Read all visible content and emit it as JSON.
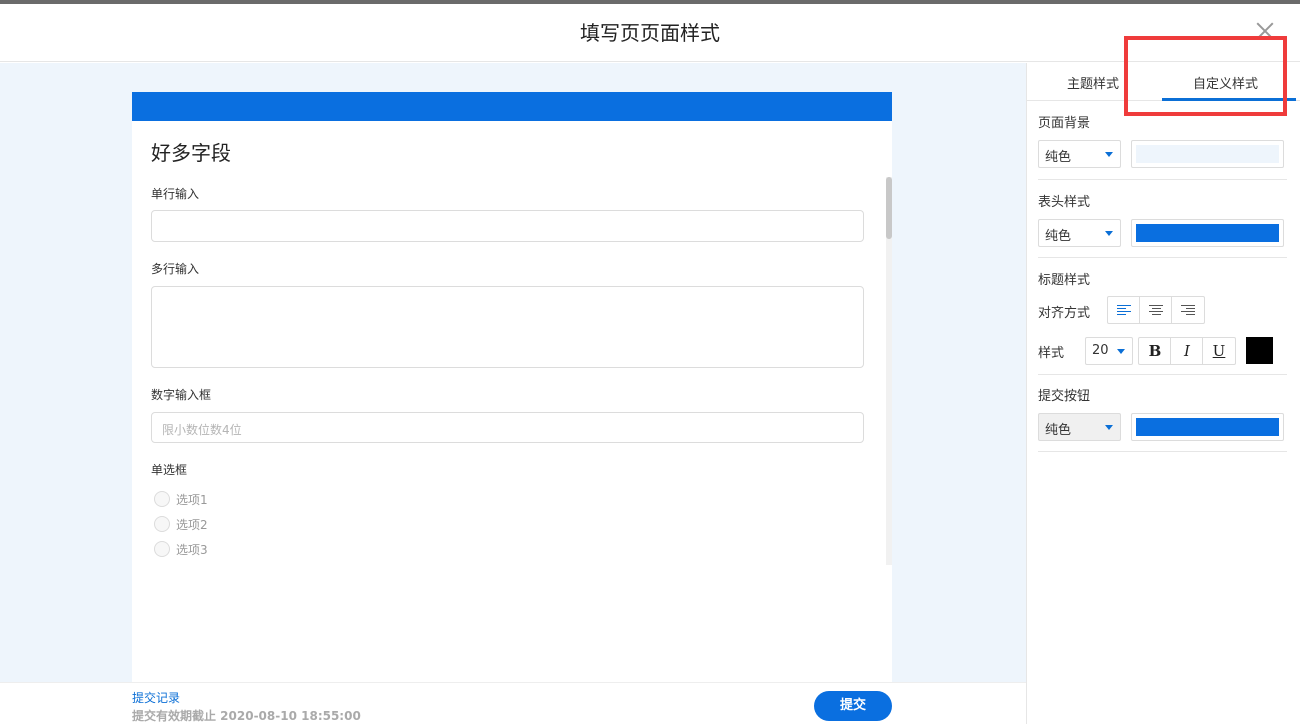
{
  "dialog": {
    "title": "填写页页面样式"
  },
  "form": {
    "title": "好多字段",
    "banner_color": "#0a6fe0",
    "fields": [
      {
        "label": "单行输入",
        "placeholder": ""
      },
      {
        "label": "多行输入",
        "placeholder": ""
      },
      {
        "label": "数字输入框",
        "placeholder": "限小数位数4位"
      },
      {
        "label": "单选框",
        "options": [
          "选项1",
          "选项2",
          "选项3"
        ]
      }
    ]
  },
  "footer": {
    "records_link": "提交记录",
    "deadline": "提交有效期截止 2020-08-10 18:55:00",
    "submit_label": "提交",
    "submit_color": "#0a6fe0"
  },
  "panel": {
    "tabs": [
      "主题样式",
      "自定义样式"
    ],
    "active_tab": "自定义样式",
    "accent_color": "#0b6fd6",
    "page_background": {
      "title": "页面背景",
      "fill_type": "纯色",
      "color": "#eef5fc"
    },
    "header_style": {
      "title": "表头样式",
      "fill_type": "纯色",
      "color": "#0a6fe0"
    },
    "title_style": {
      "title": "标题样式",
      "align_label": "对齐方式",
      "align_options": [
        "align-left",
        "align-center",
        "align-right"
      ],
      "align_selected": "align-left",
      "style_label": "样式",
      "font_size": "20",
      "format_buttons": [
        "B",
        "I",
        "U"
      ],
      "color": "#000000"
    },
    "submit_button": {
      "title": "提交按钮",
      "fill_type": "纯色",
      "color": "#0a6fe0"
    }
  },
  "annotation": {
    "highlight_color": "#ef3b3b"
  }
}
